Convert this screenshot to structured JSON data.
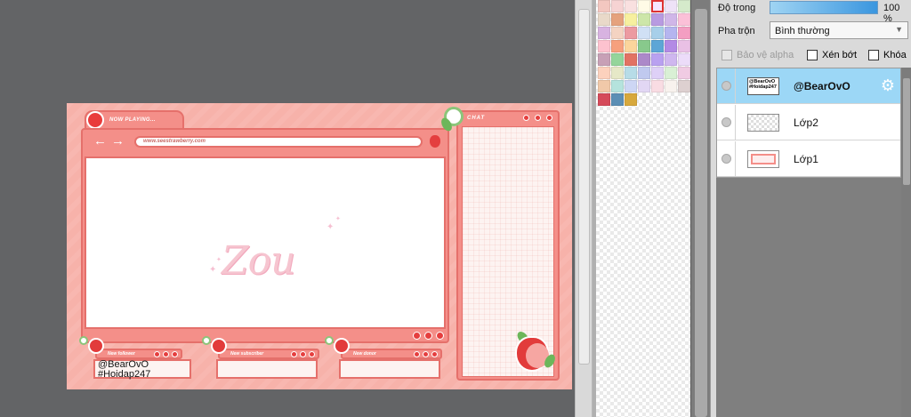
{
  "canvas": {
    "tab_title": "NOW PLAYING...",
    "url": "www.seestrawberry.com",
    "logo": "Zou",
    "chat_label": "CHAT",
    "panels": [
      {
        "label": "New follower"
      },
      {
        "label": "New subscriber"
      },
      {
        "label": "New donor"
      }
    ],
    "follower_name": "@BearOvO",
    "follower_tag": "#Hoidap247"
  },
  "palette": {
    "swatches": [
      "#f3c7c0",
      "#f6d3d3",
      "#f9e0e0",
      "#fffbe6",
      "#f7e6ff",
      "#eee2f7",
      "#d5eacb",
      "#e9d9c9",
      "#e5a27d",
      "#f7f09f",
      "#cde6a9",
      "#b89be1",
      "#d0b6e8",
      "#fbc0d8",
      "#d8b3e1",
      "#f4d3c2",
      "#ec9aa1",
      "#d0e0f5",
      "#a7cfe9",
      "#b5b5ef",
      "#f39ec2",
      "#fdc2cf",
      "#f6a07d",
      "#fbd59c",
      "#88c98c",
      "#5da6d6",
      "#b38ae5",
      "#e9c0e5",
      "#c7a0b6",
      "#94d59b",
      "#e27263",
      "#ac89c9",
      "#b9a1f0",
      "#cfb7ef",
      "#ecdcf9",
      "#fcd1bd",
      "#e6e8c7",
      "#b7dce7",
      "#c0c9ef",
      "#ded0f7",
      "#d9f0d5",
      "#f0cbe3",
      "#f1c9a9",
      "#b5e3dd",
      "#cdd6f4",
      "#e2d7f4",
      "#f9dce3",
      "#f8f2ee",
      "#ddd0d0",
      "#d54a5a",
      "#5c8fb5",
      "#d7a83c"
    ],
    "selected_index": 4
  },
  "layers": {
    "opacity_label": "Độ trong",
    "opacity_value": "100 %",
    "opacity_level": 100,
    "blend_label": "Pha trộn",
    "blend_value": "Bình thường",
    "protect_alpha": "Bảo vệ alpha",
    "clipping": "Xén bớt",
    "lock": "Khóa",
    "items": [
      {
        "name": "@BearOvO",
        "thumb_lines": [
          "@BearOvO",
          "#Hoidap247"
        ],
        "active": true
      },
      {
        "name": "Lớp2",
        "active": false
      },
      {
        "name": "Lớp1",
        "active": false
      }
    ]
  }
}
